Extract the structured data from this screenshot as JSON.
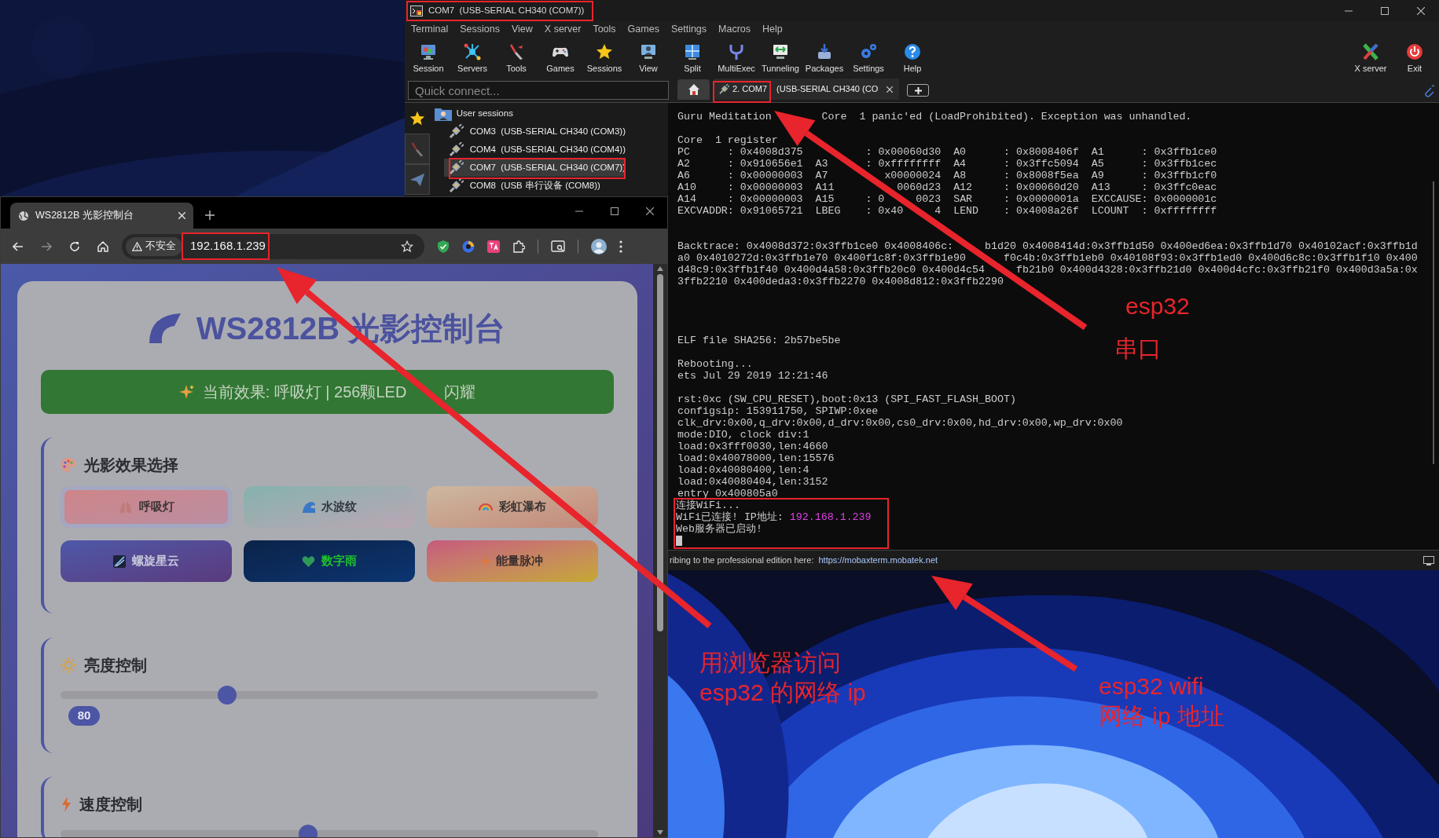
{
  "mobaxterm": {
    "title": "COM7  (USB-SERIAL CH340 (COM7))",
    "menu": [
      "Terminal",
      "Sessions",
      "View",
      "X server",
      "Tools",
      "Games",
      "Settings",
      "Macros",
      "Help"
    ],
    "toolbar": [
      {
        "label": "Session",
        "kind": "session"
      },
      {
        "label": "Servers",
        "kind": "servers"
      },
      {
        "label": "Tools",
        "kind": "tools"
      },
      {
        "label": "Games",
        "kind": "games"
      },
      {
        "label": "Sessions",
        "kind": "star"
      },
      {
        "label": "View",
        "kind": "view"
      },
      {
        "label": "Split",
        "kind": "split"
      },
      {
        "label": "MultiExec",
        "kind": "fork"
      },
      {
        "label": "Tunneling",
        "kind": "tunnel"
      },
      {
        "label": "Packages",
        "kind": "package"
      },
      {
        "label": "Settings",
        "kind": "gears"
      },
      {
        "label": "Help",
        "kind": "help"
      }
    ],
    "toolbar_right": [
      {
        "label": "X server",
        "kind": "xserver"
      },
      {
        "label": "Exit",
        "kind": "exit"
      }
    ],
    "quick_connect": {
      "placeholder": "Quick connect..."
    },
    "tab": {
      "label": "2. COM7",
      "detail": "(USB-SERIAL CH340 (CO"
    },
    "sidebar": {
      "panels": [
        {
          "kind": "star",
          "selected": true
        },
        {
          "kind": "knife",
          "selected": false
        },
        {
          "kind": "send",
          "selected": false
        }
      ],
      "folder": "User sessions",
      "items": [
        {
          "label": "COM3  (USB-SERIAL CH340 (COM3))",
          "selected": false
        },
        {
          "label": "COM4  (USB-SERIAL CH340 (COM4))",
          "selected": false
        },
        {
          "label": "COM7  (USB-SERIAL CH340 (COM7))",
          "selected": true
        },
        {
          "label": "COM8  (USB 串行设备 (COM8))",
          "selected": false
        }
      ]
    },
    "terminal": {
      "lines": [
        {
          "kind": "split",
          "segments": [
            "Guru Meditation",
            " Core  1 panic'ed (LoadProhibited). Exception was unhandled."
          ]
        },
        {
          "kind": "blank"
        },
        {
          "kind": "text",
          "text": "Core  1 register"
        },
        {
          "kind": "split",
          "segments": [
            "PC      : 0x4008d375",
            "   : 0x00060d30  A0      : 0x8008406f  A1      : 0x3ffb1ce0"
          ]
        },
        {
          "kind": "split",
          "segments": [
            "A2      : 0x910656e1  A3",
            ": 0xffffffff  A4      : 0x3ffc5094  A5      : 0x3ffb1cec"
          ]
        },
        {
          "kind": "split",
          "segments": [
            "A6      : 0x00000003  A7",
            "x00000024  A8      : 0x8008f5ea  A9      : 0x3ffb1cf0"
          ]
        },
        {
          "kind": "split",
          "segments": [
            "A10     : 0x00000003  A11",
            "0060d23  A12     : 0x00060d20  A13     : 0x3ffc0eac"
          ]
        },
        {
          "kind": "split",
          "segments": [
            "A14     : 0x00000003  A15     : 0",
            "0023  SAR     : 0x0000001a  EXCCAUSE: 0x0000001c"
          ]
        },
        {
          "kind": "split",
          "segments": [
            "EXCVADDR: 0x91065721  LBEG    : 0x40",
            "4  LEND    : 0x4008a26f  LCOUNT  : 0xffffffff"
          ]
        },
        {
          "kind": "blank"
        },
        {
          "kind": "blank"
        },
        {
          "kind": "split",
          "segments": [
            "Backtrace: 0x4008d372:0x3ffb1ce0 0x4008406c:",
            "b1d20 0x4008414d:0x3ffb1d50 0x400ed6ea:0x3ffb1d70 0x40102acf:0x3ffb1d"
          ]
        },
        {
          "kind": "split",
          "segments": [
            "a0 0x4010272d:0x3ffb1e70 0x400f1c8f:0x3ffb1e90",
            "f0c4b:0x3ffb1eb0 0x40108f93:0x3ffb1ed0 0x400d6c8c:0x3ffb1f10 0x400"
          ]
        },
        {
          "kind": "split",
          "segments": [
            "d48c9:0x3ffb1f40 0x400d4a58:0x3ffb20c0 0x400d4c54",
            "fb21b0 0x400d4328:0x3ffb21d0 0x400d4cfc:0x3ffb21f0 0x400d3a5a:0x"
          ]
        },
        {
          "kind": "text",
          "text": "3ffb2210 0x400deda3:0x3ffb2270 0x4008d812:0x3ffb2290"
        },
        {
          "kind": "blank"
        },
        {
          "kind": "blank"
        },
        {
          "kind": "blank"
        },
        {
          "kind": "blank"
        },
        {
          "kind": "text",
          "text": "ELF file SHA256: 2b57be5be"
        },
        {
          "kind": "blank"
        },
        {
          "kind": "text",
          "text": "Rebooting..."
        },
        {
          "kind": "text",
          "text": "ets Jul 29 2019 12:21:46"
        },
        {
          "kind": "blank"
        },
        {
          "kind": "text",
          "text": "rst:0xc (SW_CPU_RESET),boot:0x13 (SPI_FAST_FLASH_BOOT)"
        },
        {
          "kind": "text",
          "text": "configsip: 153911750, SPIWP:0xee"
        },
        {
          "kind": "text",
          "text": "clk_drv:0x00,q_drv:0x00,d_drv:0x00,cs0_drv:0x00,hd_drv:0x00,wp_drv:0x00"
        },
        {
          "kind": "text",
          "text": "mode:DIO, clock div:1"
        },
        {
          "kind": "text",
          "text": "load:0x3fff0030,len:4660"
        },
        {
          "kind": "text",
          "text": "load:0x40078000,len:15576"
        },
        {
          "kind": "text",
          "text": "load:0x40080400,len:4"
        },
        {
          "kind": "text",
          "text": "load:0x40080404,len:3152"
        },
        {
          "kind": "text",
          "text": "entry 0x400805a0"
        }
      ],
      "boxed_lines": [
        {
          "kind": "text",
          "text": "连接WiFi..."
        },
        {
          "kind": "ip",
          "text": "WiFi已连接! IP地址:",
          "value": "192.168.1.239"
        },
        {
          "kind": "text",
          "text": "Web服务器已启动!"
        },
        {
          "kind": "cursor"
        }
      ]
    },
    "status_bar": {
      "text": "ribing to the professional edition here:",
      "link": "https://mobaxterm.mobatek.net"
    }
  },
  "browser": {
    "tab_title": "WS2812B 光影控制台",
    "security_chip": "不安全",
    "url": "192.168.1.239",
    "page": {
      "title": "WS2812B 光影控制台",
      "status_banner": [
        "当前效果: 呼吸灯 | 256颗LED",
        "闪耀"
      ],
      "effects_heading": "光影效果选择",
      "effects": [
        {
          "label": "呼吸灯",
          "kind": "lungs",
          "selected": true
        },
        {
          "label": "水波纹",
          "kind": "wave",
          "selected": false
        },
        {
          "label": "彩虹瀑布",
          "kind": "rainbow",
          "selected": false
        },
        {
          "label": "螺旋星云",
          "kind": "nebula",
          "selected": false
        },
        {
          "label": "数字雨",
          "kind": "heart",
          "selected": false
        },
        {
          "label": "能量脉冲",
          "kind": "bolt",
          "selected": false
        }
      ],
      "brightness": {
        "heading": "亮度控制",
        "level": 0.31,
        "value": "80"
      },
      "speed": {
        "heading": "速度控制",
        "level": 0.46
      }
    }
  },
  "annotations": [
    {
      "lines": [
        "esp32",
        "串口"
      ]
    },
    {
      "lines": [
        "用浏览器访问",
        "esp32 的网络 ip"
      ]
    },
    {
      "lines": [
        "esp32 wifi",
        "网络 ip 地址"
      ]
    }
  ]
}
